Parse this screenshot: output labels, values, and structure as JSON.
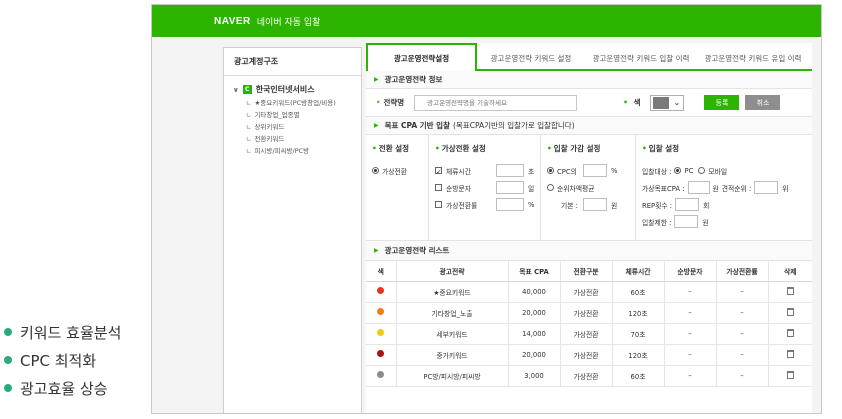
{
  "bullets": [
    {
      "label": "키워드 효율분석",
      "color": "#2aa97a"
    },
    {
      "label": "CPC 최적화",
      "color": "#2aa97a"
    },
    {
      "label": "광고효율 상승",
      "color": "#2aa97a"
    }
  ],
  "app": {
    "logo": "NAVER",
    "title": "네이버 자동 입찰",
    "accent": "#2db400"
  },
  "tree": {
    "header": "광고계정구조",
    "root": {
      "badge": "C",
      "label": "한국인터넷서비스"
    },
    "items": [
      "★중요키워드(PC방창업/비용)",
      "기타창업_업종별",
      "상위키워드",
      "전환키워드",
      "피시방/피씨방/PC방"
    ]
  },
  "tabs": [
    "광고운영전략설정",
    "광고운영전략 키워드 설정",
    "광고운영전략 키워드 입찰 이력",
    "광고운영전략 키워드 유입 이력"
  ],
  "info": {
    "section_title": "광고운영전략 정보",
    "name_label": "전략명",
    "name_placeholder": "광고운영전략명을 기술하세요",
    "color_label": "색",
    "register_label": "등록",
    "cancel_label": "취소"
  },
  "cpa": {
    "section_title": "목표 CPA 기반 입찰",
    "section_note": "(목표CPA기반의 입찰가로 입찰합니다)",
    "conversion": {
      "title": "전환 설정",
      "option": "가상전환"
    },
    "virtual": {
      "title": "가상전환 설정",
      "rows": [
        {
          "label": "체류시간",
          "unit": "초",
          "checked": true
        },
        {
          "label": "순방문자",
          "unit": "일",
          "checked": false
        },
        {
          "label": "가상전환률",
          "unit": "%",
          "checked": false
        }
      ]
    },
    "weight": {
      "title": "입찰 가감 설정",
      "opt1": "CPC의",
      "opt1_unit": "%",
      "opt2": "순위차액평균",
      "base_label": "기본 :",
      "base_unit": "원"
    },
    "bid": {
      "title": "입찰 설정",
      "target_label": "입찰대상 :",
      "target_pc": "PC",
      "target_mobile": "모바일",
      "virtual_cpa_label": "가상목표CPA :",
      "virtual_cpa_unit": "원",
      "rank_label": "견적순위 :",
      "rank_unit": "위",
      "repeat_label": "REP횟수 :",
      "repeat_unit": "회",
      "limit_label": "입찰제한 :",
      "limit_unit": "원"
    }
  },
  "list": {
    "section_title": "광고운영전략 리스트",
    "headers": [
      "색",
      "광고전략",
      "목표 CPA",
      "전환구분",
      "체류시간",
      "순방문자",
      "가상전환률",
      "삭제"
    ],
    "rows": [
      {
        "color": "#e8341c",
        "name": "★중요키워드",
        "cpa": "40,000",
        "type": "가상전환",
        "stay": "60초",
        "visitors": "–",
        "rate": "–"
      },
      {
        "color": "#f07c1a",
        "name": "기타창업_노출",
        "cpa": "20,000",
        "type": "가상전환",
        "stay": "120초",
        "visitors": "–",
        "rate": "–"
      },
      {
        "color": "#f5c518",
        "name": "세부키워드",
        "cpa": "14,000",
        "type": "가상전환",
        "stay": "70초",
        "visitors": "–",
        "rate": "–"
      },
      {
        "color": "#a8140f",
        "name": "중가키워드",
        "cpa": "20,000",
        "type": "가상전환",
        "stay": "120초",
        "visitors": "–",
        "rate": "–"
      },
      {
        "color": "#8c8c8c",
        "name": "PC방/피시방/피씨방",
        "cpa": "3,000",
        "type": "가상전환",
        "stay": "60초",
        "visitors": "–",
        "rate": "–"
      }
    ]
  }
}
